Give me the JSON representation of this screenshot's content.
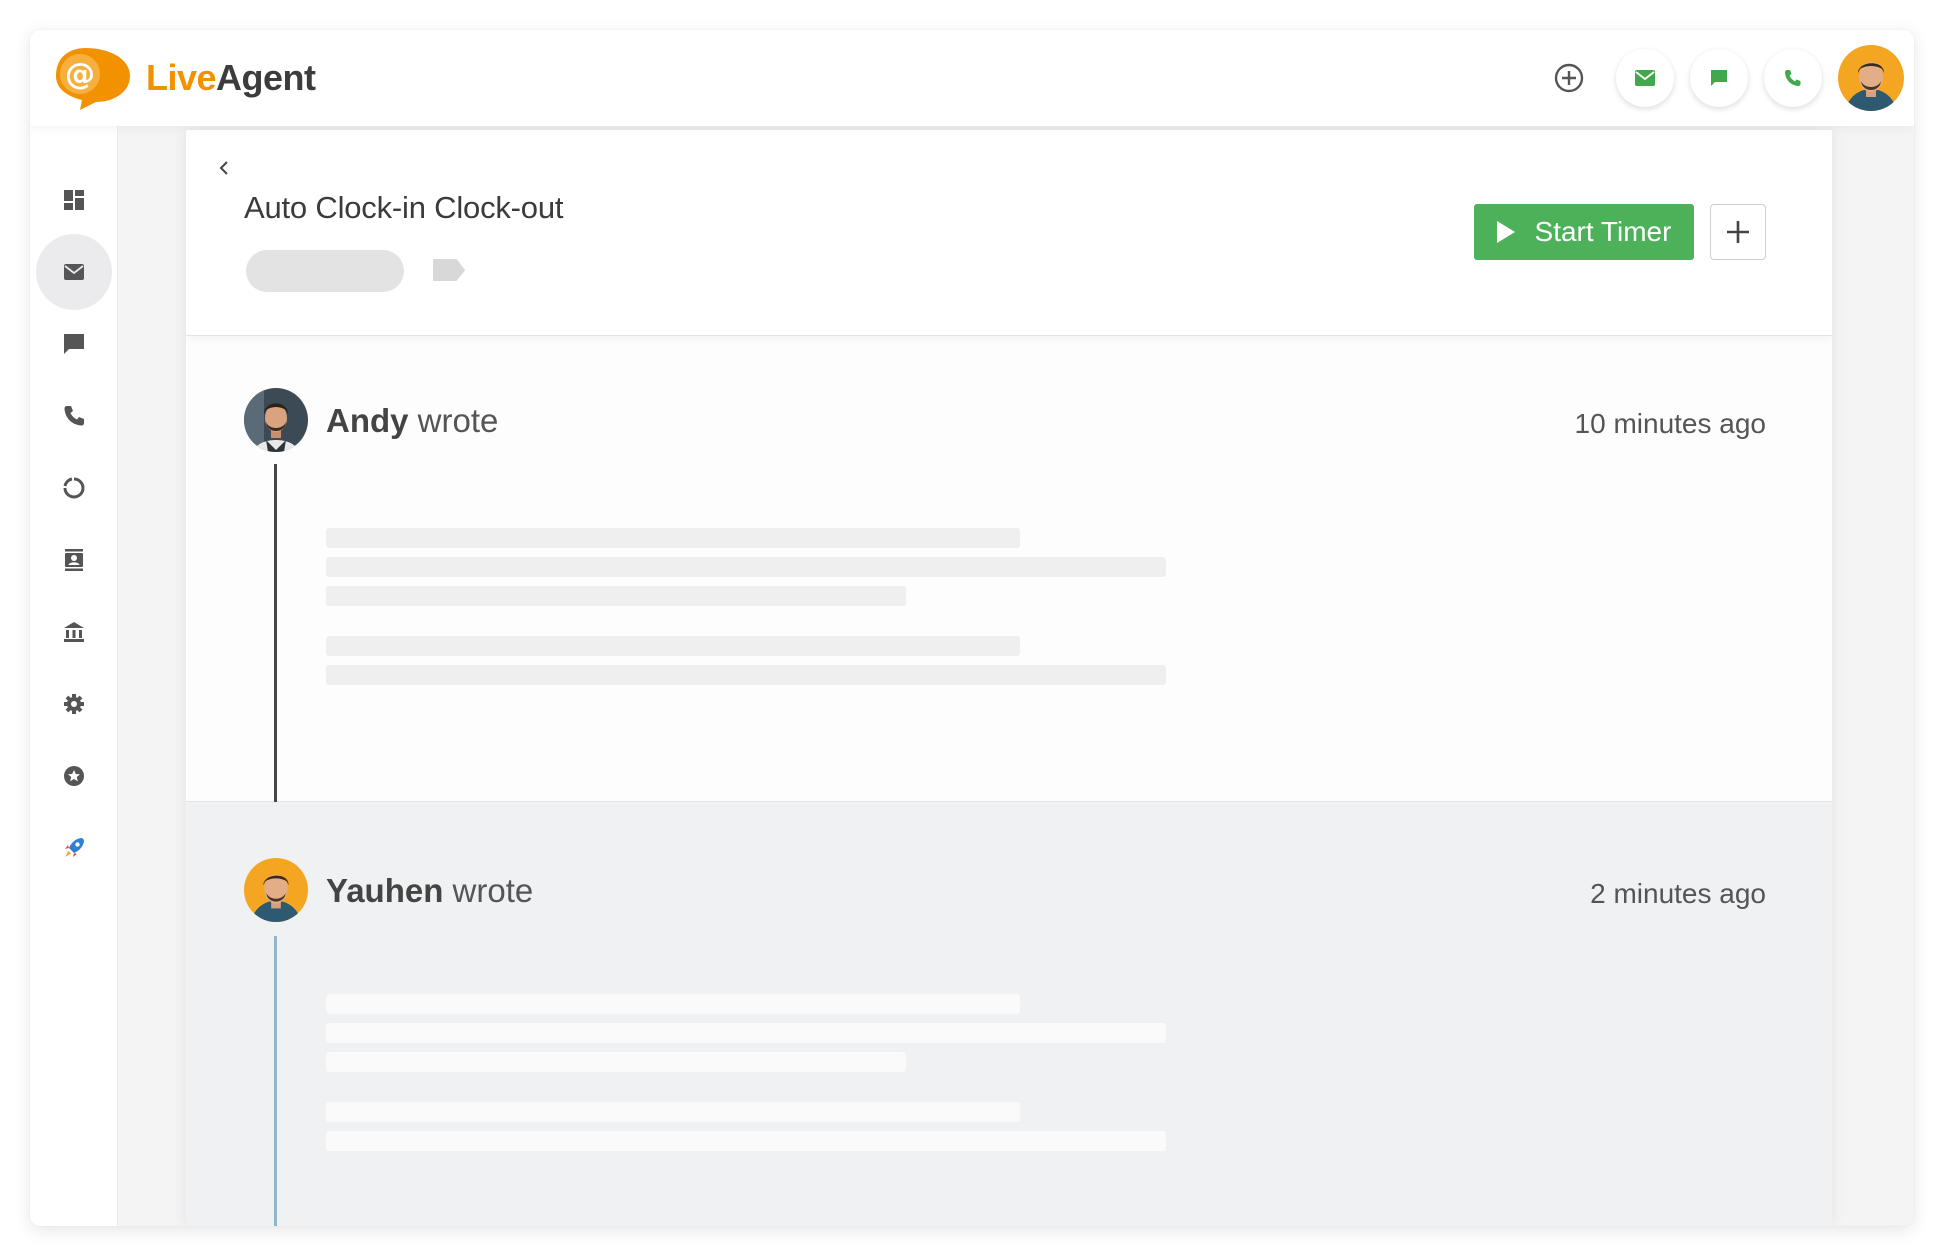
{
  "app": {
    "brand_live": "Live",
    "brand_agent": "Agent",
    "colors": {
      "accent": "#f29200",
      "primary_green": "#4db15a",
      "top_icon_green": "#41a94c"
    }
  },
  "topbar": {
    "icons": [
      "plus-circle-icon",
      "email-icon",
      "chat-icon",
      "phone-icon"
    ]
  },
  "sidebar": {
    "items": [
      {
        "icon": "dashboard-icon",
        "active": false
      },
      {
        "icon": "email-icon",
        "active": true
      },
      {
        "icon": "chat-icon",
        "active": false
      },
      {
        "icon": "phone-icon",
        "active": false
      },
      {
        "icon": "reports-icon",
        "active": false
      },
      {
        "icon": "contacts-icon",
        "active": false
      },
      {
        "icon": "knowledgebase-icon",
        "active": false
      },
      {
        "icon": "settings-icon",
        "active": false
      },
      {
        "icon": "star-icon",
        "active": false
      },
      {
        "icon": "rocket-icon",
        "active": false
      }
    ]
  },
  "ticket": {
    "title": "Auto Clock-in Clock-out",
    "start_timer_label": "Start Timer"
  },
  "messages": [
    {
      "author": "Andy",
      "verb": "wrote",
      "time": "10 minutes ago"
    },
    {
      "author": "Yauhen",
      "verb": "wrote",
      "time": "2 minutes ago"
    }
  ]
}
